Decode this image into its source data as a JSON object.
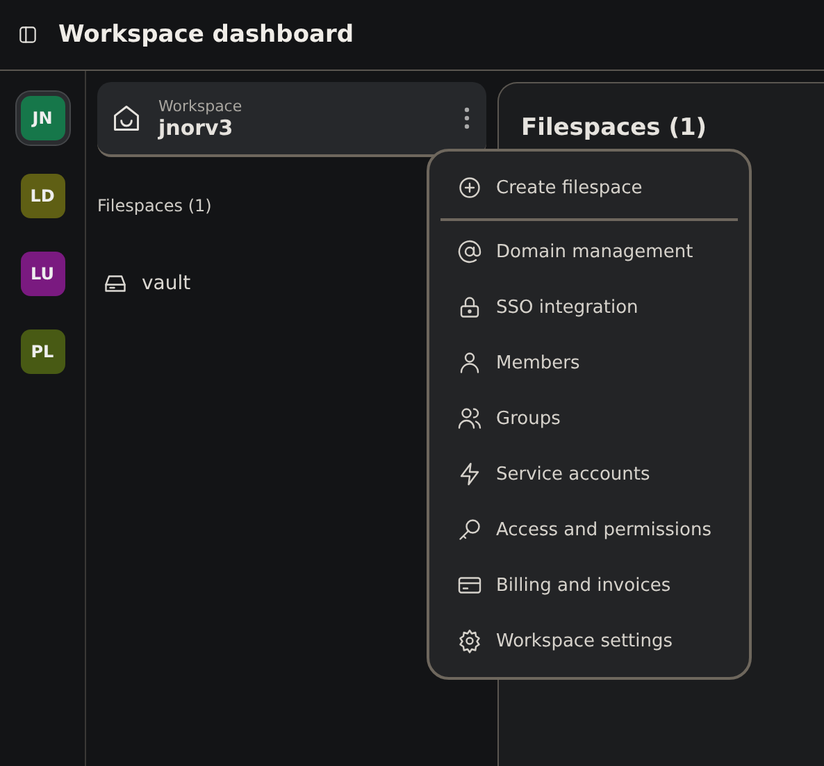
{
  "header": {
    "title": "Workspace dashboard"
  },
  "workspaces": [
    {
      "initials": "JN",
      "color": "#16774a",
      "selected": true
    },
    {
      "initials": "LD",
      "color": "#5f5f14",
      "selected": false
    },
    {
      "initials": "LU",
      "color": "#7a1a80",
      "selected": false
    },
    {
      "initials": "PL",
      "color": "#485a14",
      "selected": false
    }
  ],
  "workspace_card": {
    "label": "Workspace",
    "name": "jnorv3"
  },
  "sidebar": {
    "heading": "Filespaces (1)",
    "items": [
      {
        "label": "vault"
      }
    ]
  },
  "main": {
    "title": "Filespaces (1)"
  },
  "menu": {
    "sections": [
      [
        "Create filespace"
      ],
      [
        "Domain management",
        "SSO integration",
        "Members",
        "Groups",
        "Service accounts",
        "Access and permissions",
        "Billing and invoices",
        "Workspace settings"
      ]
    ]
  }
}
